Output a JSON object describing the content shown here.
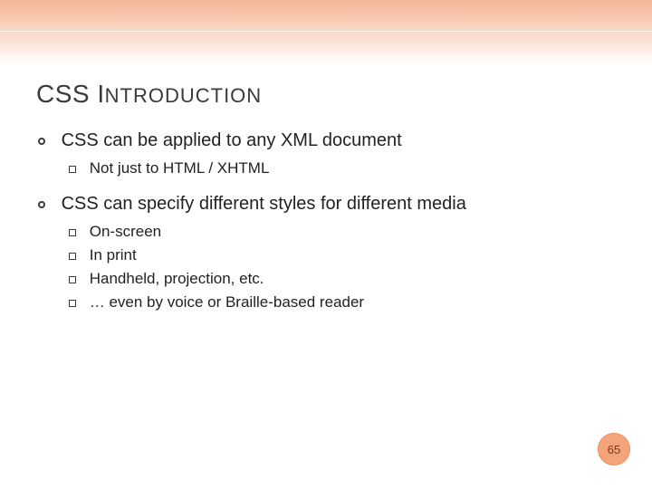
{
  "title": {
    "word1_caps": "CSS",
    "word2_capI": "I",
    "word2_rest": "NTRODUCTION"
  },
  "bullets": [
    {
      "text": "CSS can be applied to any XML document",
      "children": [
        {
          "text": "Not just to HTML / XHTML"
        }
      ]
    },
    {
      "text": "CSS can specify different styles for different media",
      "children": [
        {
          "text": "On-screen"
        },
        {
          "text": "In print"
        },
        {
          "text": "Handheld, projection, etc."
        },
        {
          "text": "… even by voice or Braille-based reader"
        }
      ]
    }
  ],
  "page_number": "65"
}
